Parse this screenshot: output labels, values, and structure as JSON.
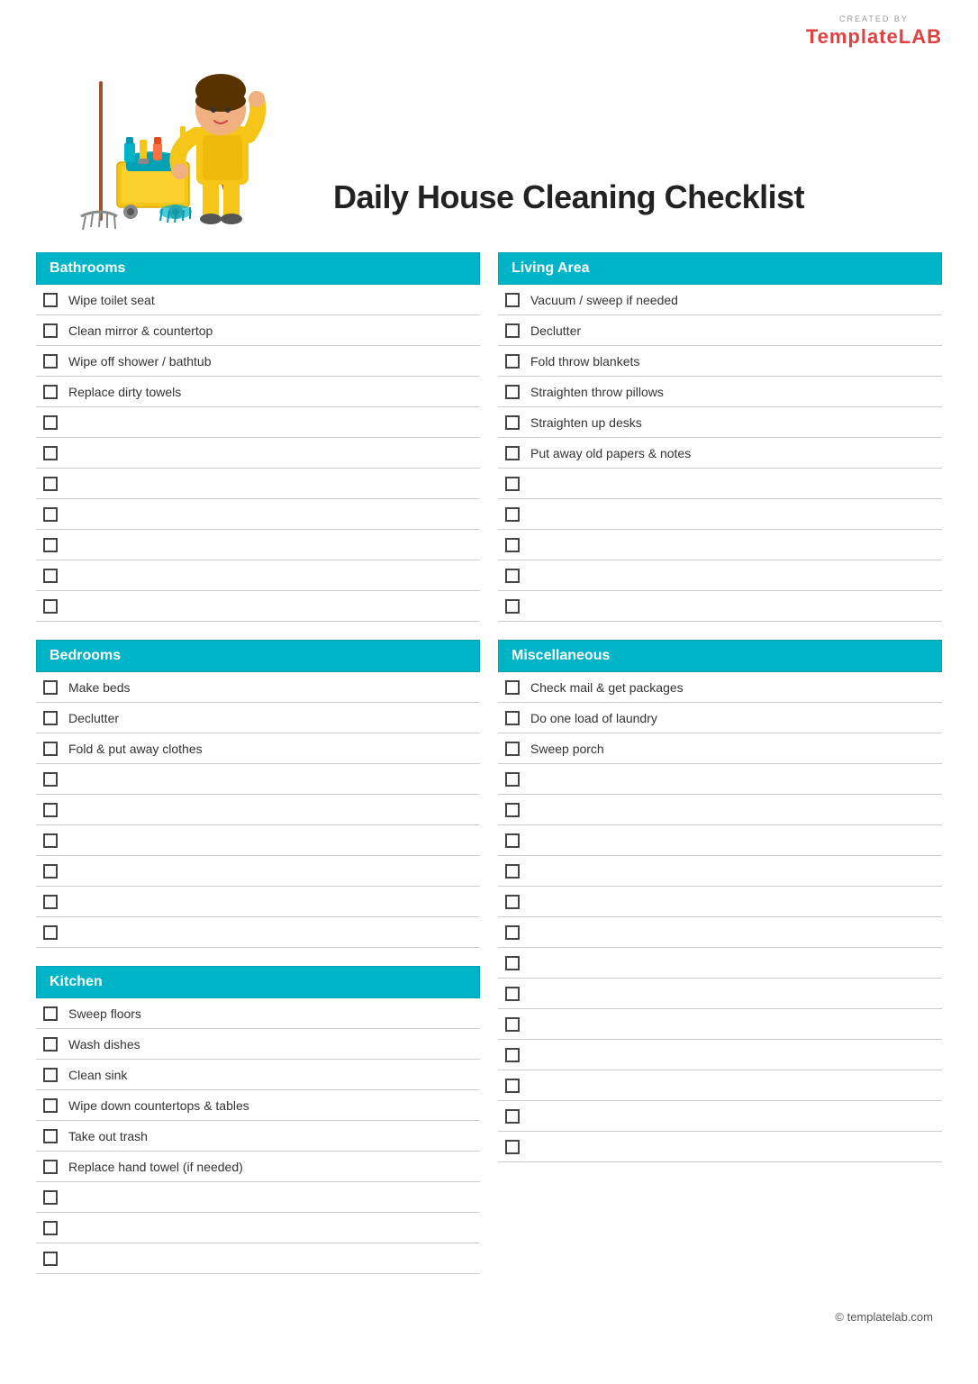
{
  "logo": {
    "created_by": "CREATED BY",
    "brand_part1": "Template",
    "brand_part2": "LAB"
  },
  "title": "Daily House Cleaning Checklist",
  "footer": "© templatelab.com",
  "sections": {
    "left": [
      {
        "id": "bathrooms",
        "header": "Bathrooms",
        "items": [
          "Wipe toilet seat",
          "Clean mirror & countertop",
          "Wipe off shower / bathtub",
          "Replace dirty towels",
          "",
          "",
          "",
          "",
          "",
          "",
          ""
        ]
      },
      {
        "id": "bedrooms",
        "header": "Bedrooms",
        "items": [
          "Make beds",
          "Declutter",
          "Fold & put away clothes",
          "",
          "",
          "",
          "",
          "",
          ""
        ]
      },
      {
        "id": "kitchen",
        "header": "Kitchen",
        "items": [
          "Sweep floors",
          "Wash dishes",
          "Clean sink",
          "Wipe down countertops & tables",
          "Take out trash",
          "Replace hand towel (if needed)",
          "",
          "",
          ""
        ]
      }
    ],
    "right": [
      {
        "id": "living-area",
        "header": "Living Area",
        "items": [
          "Vacuum / sweep if needed",
          "Declutter",
          "Fold throw blankets",
          "Straighten throw pillows",
          "Straighten up desks",
          "Put away old papers & notes",
          "",
          "",
          "",
          "",
          ""
        ]
      },
      {
        "id": "miscellaneous",
        "header": "Miscellaneous",
        "items": [
          "Check mail & get packages",
          "Do one load of laundry",
          "Sweep porch",
          "",
          "",
          "",
          "",
          "",
          "",
          "",
          "",
          "",
          "",
          "",
          "",
          ""
        ]
      }
    ]
  }
}
